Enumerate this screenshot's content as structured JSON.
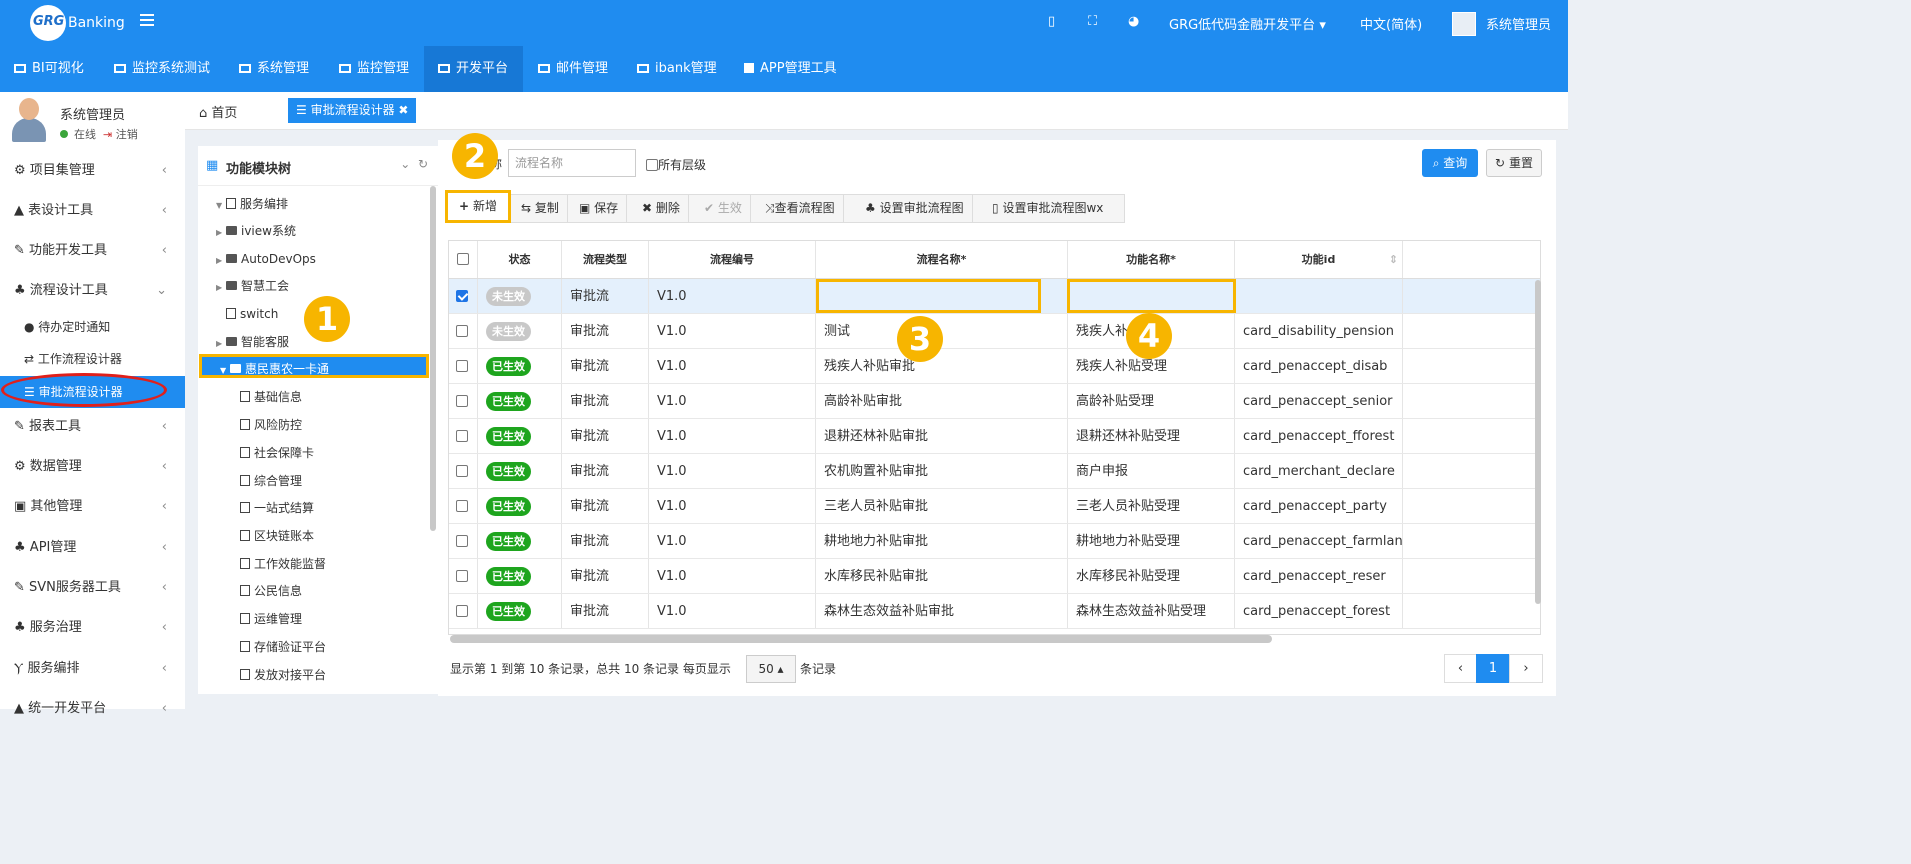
{
  "header": {
    "logo_mark": "GRG",
    "logo_text": "Banking",
    "platform_dropdown": "GRG低代码金融开发平台",
    "language": "中文(简体)",
    "admin": "系统管理员"
  },
  "menubar": {
    "items": [
      "BI可视化",
      "监控系统测试",
      "系统管理",
      "监控管理",
      "开发平台",
      "邮件管理",
      "ibank管理",
      "APP管理工具"
    ],
    "active": "开发平台"
  },
  "user": {
    "name": "系统管理员",
    "status": "在线",
    "logout": "注销"
  },
  "sidebar": {
    "groups": [
      "项目集管理",
      "表设计工具",
      "功能开发工具",
      "流程设计工具",
      "报表工具",
      "数据管理",
      "其他管理",
      "API管理",
      "SVN服务器工具",
      "服务治理",
      "服务编排",
      "统一开发平台"
    ],
    "flow_subitems": [
      "待办定时通知",
      "工作流程设计器",
      "审批流程设计器"
    ],
    "active": "审批流程设计器"
  },
  "tabs": {
    "home": "首页",
    "current": "审批流程设计器 ✖"
  },
  "tree": {
    "title": "功能模块树",
    "root": "服务编排",
    "level1": [
      "iview系统",
      "AutoDevOps",
      "智慧工会",
      "switch",
      "智能客服",
      "惠民惠农一卡通"
    ],
    "children": [
      "基础信息",
      "风险防控",
      "社会保障卡",
      "综合管理",
      "一站式结算",
      "区块链账本",
      "工作效能监督",
      "公民信息",
      "运维管理",
      "存储验证平台",
      "发放对接平台"
    ]
  },
  "search": {
    "label": "称",
    "placeholder": "流程名称",
    "all_levels": "所有层级",
    "query": "查询",
    "reset": "重置"
  },
  "toolbar": {
    "add": "新增",
    "copy": "复制",
    "save": "保存",
    "delete": "删除",
    "activate": "生效",
    "view": "查看流程图",
    "set": "设置审批流程图",
    "setwx": "设置审批流程图wx"
  },
  "table": {
    "headers": [
      "状态",
      "流程类型",
      "流程编号",
      "流程名称*",
      "功能名称*",
      "功能id"
    ],
    "rows": [
      {
        "status": "未生效",
        "type": "审批流",
        "ver": "V1.0",
        "name": "",
        "func": "",
        "fid": ""
      },
      {
        "status": "未生效",
        "type": "审批流",
        "ver": "V1.0",
        "name": "测试",
        "func": "残疾人补贴",
        "fid": "card_disability_pension"
      },
      {
        "status": "已生效",
        "type": "审批流",
        "ver": "V1.0",
        "name": "残疾人补贴审批",
        "func": "残疾人补贴受理",
        "fid": "card_penaccept_disab"
      },
      {
        "status": "已生效",
        "type": "审批流",
        "ver": "V1.0",
        "name": "高龄补贴审批",
        "func": "高龄补贴受理",
        "fid": "card_penaccept_senior"
      },
      {
        "status": "已生效",
        "type": "审批流",
        "ver": "V1.0",
        "name": "退耕还林补贴审批",
        "func": "退耕还林补贴受理",
        "fid": "card_penaccept_fforest"
      },
      {
        "status": "已生效",
        "type": "审批流",
        "ver": "V1.0",
        "name": "农机购置补贴审批",
        "func": "商户申报",
        "fid": "card_merchant_declare"
      },
      {
        "status": "已生效",
        "type": "审批流",
        "ver": "V1.0",
        "name": "三老人员补贴审批",
        "func": "三老人员补贴受理",
        "fid": "card_penaccept_party"
      },
      {
        "status": "已生效",
        "type": "审批流",
        "ver": "V1.0",
        "name": "耕地地力补贴审批",
        "func": "耕地地力补贴受理",
        "fid": "card_penaccept_farmland"
      },
      {
        "status": "已生效",
        "type": "审批流",
        "ver": "V1.0",
        "name": "水库移民补贴审批",
        "func": "水库移民补贴受理",
        "fid": "card_penaccept_reser"
      },
      {
        "status": "已生效",
        "type": "审批流",
        "ver": "V1.0",
        "name": "森林生态效益补贴审批",
        "func": "森林生态效益补贴受理",
        "fid": "card_penaccept_forest"
      }
    ]
  },
  "pagination": {
    "info": "显示第 1 到第 10 条记录，总共 10 条记录 每页显示",
    "page_size": "50 ▴",
    "suffix": "条记录",
    "prev": "‹",
    "current": "1",
    "next": "›"
  },
  "annotations": {
    "n1": "1",
    "n2": "2",
    "n3": "3",
    "n4": "4"
  },
  "colors": {
    "primary": "#1f8cf0",
    "highlight": "#f7b500",
    "active_badge": "#1ea51e",
    "inactive_badge": "#c8c8c8",
    "circle": "#e0201b"
  }
}
